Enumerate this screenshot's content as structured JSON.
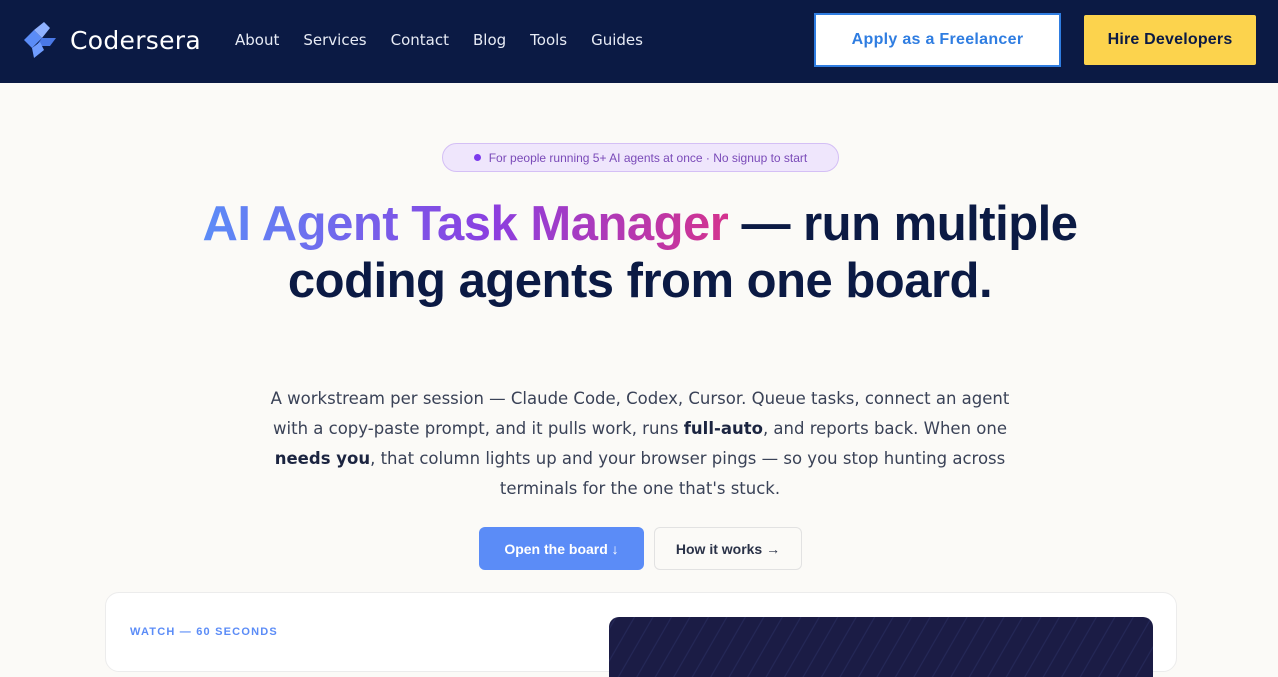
{
  "header": {
    "brand": "Codersera",
    "nav": [
      "About",
      "Services",
      "Contact",
      "Blog",
      "Tools",
      "Guides"
    ],
    "freelancer_label": "Apply as a Freelancer",
    "hire_label": "Hire Developers"
  },
  "hero": {
    "pill_text": "For people running 5+ AI agents at once · No signup to start",
    "title_highlight": "AI Agent Task Manager",
    "title_rest": " — run multiple coding agents from one board.",
    "sub": {
      "part1": "A workstream per session — Claude Code, Codex, Cursor. Queue tasks, connect an agent with a copy-paste prompt, and it pulls work, runs ",
      "bold1": "full-auto",
      "part2": ", and reports back. When one ",
      "bold2": "needs you",
      "part3": ", that column lights up and your browser pings — so you stop hunting across terminals for the one that's stuck."
    },
    "open_label": "Open the board ↓",
    "how_label": "How it works →"
  },
  "card": {
    "watch_label": "WATCH — 60 SECONDS"
  },
  "colors": {
    "header_bg": "#0b1a44",
    "accent_blue": "#5b8cf7",
    "hire_yellow": "#fcd34d",
    "freelancer_border": "#2f7de1"
  }
}
